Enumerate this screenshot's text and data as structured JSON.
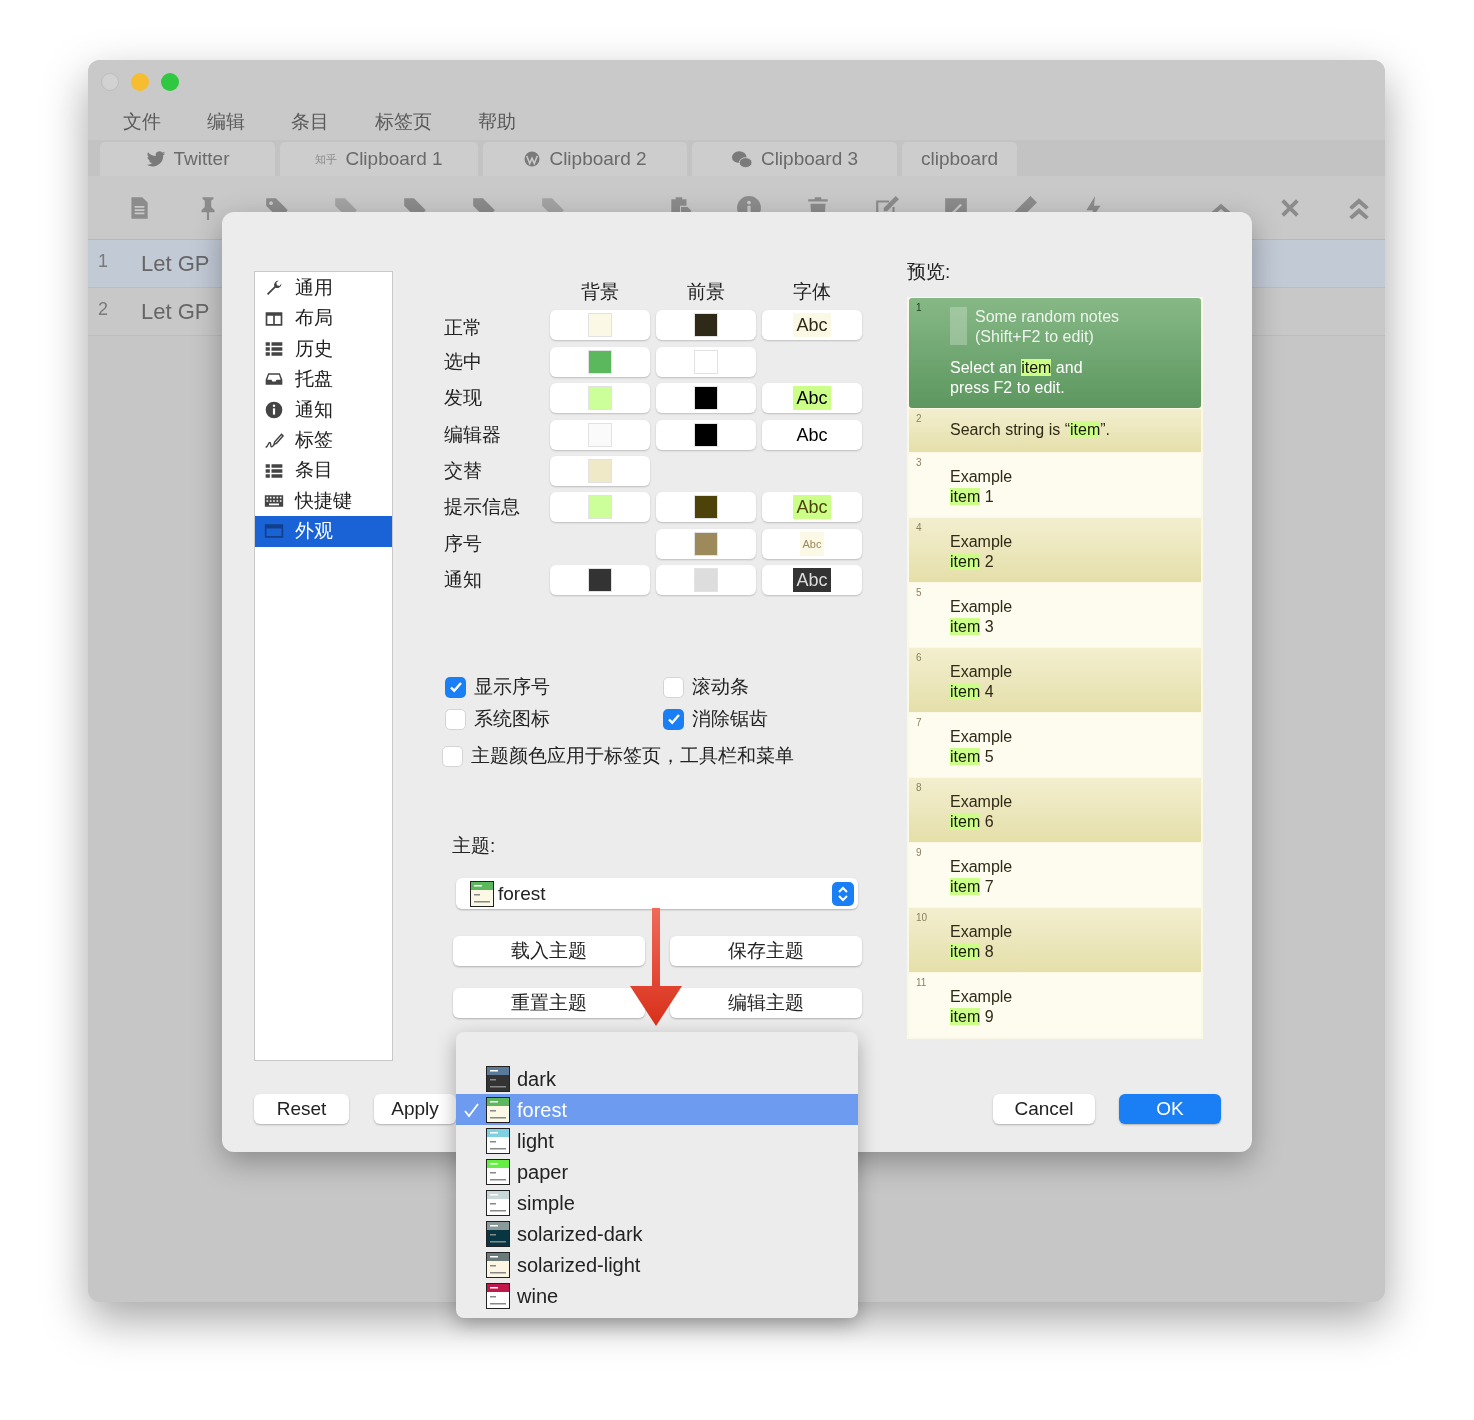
{
  "window": {
    "menu": [
      "文件",
      "编辑",
      "条目",
      "标签页",
      "帮助"
    ],
    "tabs": [
      {
        "label": "Twitter",
        "kind": "bird"
      },
      {
        "label": "Clipboard 1",
        "kind": "badge",
        "badge": "知乎"
      },
      {
        "label": "Clipboard 2",
        "kind": "globe"
      },
      {
        "label": "Clipboard 3",
        "kind": "chat"
      },
      {
        "label": "clipboard",
        "kind": "plain"
      }
    ],
    "rows": [
      {
        "number": "1",
        "text": "Let GP",
        "selected": true
      },
      {
        "number": "2",
        "text": "Let GP",
        "selected": false
      }
    ]
  },
  "dialog": {
    "sidebar": [
      {
        "label": "通用",
        "selected": false
      },
      {
        "label": "布局",
        "selected": false
      },
      {
        "label": "历史",
        "selected": false
      },
      {
        "label": "托盘",
        "selected": false
      },
      {
        "label": "通知",
        "selected": false
      },
      {
        "label": "标签",
        "selected": false
      },
      {
        "label": "条目",
        "selected": false
      },
      {
        "label": "快捷键",
        "selected": false
      },
      {
        "label": "外观",
        "selected": true
      }
    ],
    "colors": {
      "columns": [
        "背景",
        "前景",
        "字体"
      ],
      "rows": [
        {
          "label": "正常",
          "background": {
            "color": "#fbf8e6"
          },
          "foreground": {
            "color": "#2f2a17"
          },
          "font": {
            "text": "Abc",
            "fill": {
              "color": "#fbf8e6"
            }
          }
        },
        {
          "label": "选中",
          "background": {
            "color": "#5cb85c"
          },
          "foreground": {
            "color": "#ffffff"
          }
        },
        {
          "label": "发现",
          "background": {
            "color": "#ccff99"
          },
          "foreground": {
            "color": "#000000"
          },
          "font": {
            "text": "Abc",
            "fill": {
              "color": "#ccff88"
            }
          }
        },
        {
          "label": "编辑器",
          "background": {
            "color": "#fafafa"
          },
          "foreground": {
            "color": "#000000"
          },
          "font": {
            "text": "Abc",
            "fill": {
              "color": "#ffffff"
            }
          }
        },
        {
          "label": "交替",
          "background": {
            "color": "#efe9c8"
          }
        },
        {
          "label": "提示信息",
          "background": {
            "color": "#ccff99"
          },
          "foreground": {
            "color": "#4d4308"
          },
          "font": {
            "text": "Abc",
            "fill": {
              "color": "#ccff88"
            }
          }
        },
        {
          "label": "序号",
          "kind": "number",
          "foreground": {
            "color": "#9c8a5a"
          },
          "font": {
            "text": "Abc",
            "fill": {
              "color": "#fbf8e6"
            }
          }
        },
        {
          "label": "通知",
          "background": {
            "color": "#333333"
          },
          "foreground": {
            "color": "#dddddd"
          },
          "font": {
            "text": "Abc",
            "fill": {
              "color": "#333333"
            }
          }
        }
      ]
    },
    "checkboxes": [
      {
        "label": "显示序号",
        "checked": true
      },
      {
        "label": "滚动条",
        "checked": false
      },
      {
        "label": "系统图标",
        "checked": false
      },
      {
        "label": "消除锯齿",
        "checked": true
      },
      {
        "label": "主题颜色应用于标签页，工具栏和菜单",
        "checked": false,
        "kind": "wide"
      }
    ],
    "theme": {
      "label": "主题:",
      "value": "forest",
      "color": "#5cb85c",
      "body": {
        "color": "#fbf8e6"
      }
    },
    "theme_buttons": [
      "载入主题",
      "保存主题",
      "重置主题",
      "编辑主题"
    ],
    "preview": {
      "title": "预览:",
      "items": [
        {
          "number": "1",
          "selected": true,
          "alternate": false,
          "notes": "Some random notes\n(Shift+F2 to edit)",
          "parts": [
            {
              "text": "Select an ",
              "highlight": false
            },
            {
              "text": "item",
              "highlight": true
            },
            {
              "text": " and\npress F2 to edit.",
              "highlight": false
            }
          ]
        },
        {
          "number": "2",
          "selected": false,
          "alternate": true,
          "parts": [
            {
              "text": "Search string is “",
              "highlight": false
            },
            {
              "text": "item",
              "highlight": true
            },
            {
              "text": "”.",
              "highlight": false
            }
          ]
        },
        {
          "number": "3",
          "selected": false,
          "alternate": false,
          "parts": [
            {
              "text": "Example\n",
              "highlight": false
            },
            {
              "text": "item",
              "highlight": true
            },
            {
              "text": " 1",
              "highlight": false
            }
          ]
        },
        {
          "number": "4",
          "selected": false,
          "alternate": true,
          "parts": [
            {
              "text": "Example\n",
              "highlight": false
            },
            {
              "text": "item",
              "highlight": true
            },
            {
              "text": " 2",
              "highlight": false
            }
          ]
        },
        {
          "number": "5",
          "selected": false,
          "alternate": false,
          "parts": [
            {
              "text": "Example\n",
              "highlight": false
            },
            {
              "text": "item",
              "highlight": true
            },
            {
              "text": " 3",
              "highlight": false
            }
          ]
        },
        {
          "number": "6",
          "selected": false,
          "alternate": true,
          "parts": [
            {
              "text": "Example\n",
              "highlight": false
            },
            {
              "text": "item",
              "highlight": true
            },
            {
              "text": " 4",
              "highlight": false
            }
          ]
        },
        {
          "number": "7",
          "selected": false,
          "alternate": false,
          "parts": [
            {
              "text": "Example\n",
              "highlight": false
            },
            {
              "text": "item",
              "highlight": true
            },
            {
              "text": " 5",
              "highlight": false
            }
          ]
        },
        {
          "number": "8",
          "selected": false,
          "alternate": true,
          "parts": [
            {
              "text": "Example\n",
              "highlight": false
            },
            {
              "text": "item",
              "highlight": true
            },
            {
              "text": " 6",
              "highlight": false
            }
          ]
        },
        {
          "number": "9",
          "selected": false,
          "alternate": false,
          "parts": [
            {
              "text": "Example\n",
              "highlight": false
            },
            {
              "text": "item",
              "highlight": true
            },
            {
              "text": " 7",
              "highlight": false
            }
          ]
        },
        {
          "number": "10",
          "selected": false,
          "alternate": true,
          "parts": [
            {
              "text": "Example\n",
              "highlight": false
            },
            {
              "text": "item",
              "highlight": true
            },
            {
              "text": " 8",
              "highlight": false
            }
          ]
        },
        {
          "number": "11",
          "selected": false,
          "alternate": false,
          "parts": [
            {
              "text": "Example\n",
              "highlight": false
            },
            {
              "text": "item",
              "highlight": true
            },
            {
              "text": " 9",
              "highlight": false
            }
          ]
        }
      ]
    },
    "buttons": [
      {
        "label": "Reset",
        "kind": "normal"
      },
      {
        "label": "Apply",
        "kind": "normal"
      },
      {
        "label": "Cancel",
        "kind": "normal"
      },
      {
        "label": "OK",
        "kind": "default"
      }
    ],
    "theme_menu": [
      {
        "label": "dark",
        "selected": false,
        "color": "#5a7a9a",
        "body": {
          "color": "#333333"
        }
      },
      {
        "label": "forest",
        "selected": true,
        "color": "#5cb85c",
        "body": {
          "color": "#fbf8e6"
        }
      },
      {
        "label": "light",
        "selected": false,
        "color": "#7fd0e0",
        "body": {
          "color": "#ffffff"
        }
      },
      {
        "label": "paper",
        "selected": false,
        "color": "#66ee44",
        "body": {
          "color": "#ffffff"
        }
      },
      {
        "label": "simple",
        "selected": false,
        "color": "#c8d8d8",
        "body": {
          "color": "#ffffff"
        }
      },
      {
        "label": "solarized-dark",
        "selected": false,
        "color": "#8a9a9a",
        "body": {
          "color": "#073642"
        }
      },
      {
        "label": "solarized-light",
        "selected": false,
        "color": "#6a7a7a",
        "body": {
          "color": "#fdf6e3"
        }
      },
      {
        "label": "wine",
        "selected": false,
        "color": "#c0184a",
        "body": {
          "color": "#ffffff"
        }
      }
    ]
  }
}
